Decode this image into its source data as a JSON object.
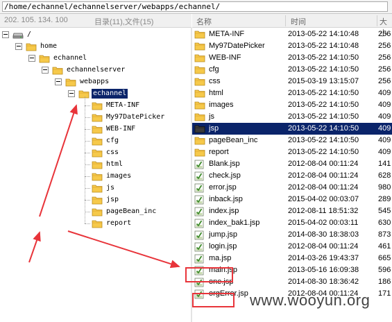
{
  "path": "/home/echannel/echannelserver/webapps/echannel/",
  "tree_header": {
    "host": "202. 105. 134. 100",
    "summary": "目录(11),文件(15)"
  },
  "list_header": {
    "name": "名称",
    "time": "时间",
    "size": "大小"
  },
  "tree": [
    {
      "label": "/",
      "level": 0,
      "kind": "drive"
    },
    {
      "label": "home",
      "level": 1,
      "kind": "folder"
    },
    {
      "label": "echannel",
      "level": 2,
      "kind": "folder"
    },
    {
      "label": "echannelserver",
      "level": 3,
      "kind": "folder"
    },
    {
      "label": "webapps",
      "level": 4,
      "kind": "folder"
    },
    {
      "label": "echannel",
      "level": 5,
      "kind": "folder",
      "selected": true
    },
    {
      "label": "META-INF",
      "level": 6,
      "kind": "folder"
    },
    {
      "label": "My97DatePicker",
      "level": 6,
      "kind": "folder"
    },
    {
      "label": "WEB-INF",
      "level": 6,
      "kind": "folder"
    },
    {
      "label": "cfg",
      "level": 6,
      "kind": "folder"
    },
    {
      "label": "css",
      "level": 6,
      "kind": "folder"
    },
    {
      "label": "html",
      "level": 6,
      "kind": "folder"
    },
    {
      "label": "images",
      "level": 6,
      "kind": "folder"
    },
    {
      "label": "js",
      "level": 6,
      "kind": "folder"
    },
    {
      "label": "jsp",
      "level": 6,
      "kind": "folder"
    },
    {
      "label": "pageBean_inc",
      "level": 6,
      "kind": "folder"
    },
    {
      "label": "report",
      "level": 6,
      "kind": "folder"
    }
  ],
  "files": [
    {
      "name": "META-INF",
      "time": "2013-05-22 14:10:48",
      "size": "256",
      "type": "folder"
    },
    {
      "name": "My97DatePicker",
      "time": "2013-05-22 14:10:48",
      "size": "256",
      "type": "folder"
    },
    {
      "name": "WEB-INF",
      "time": "2013-05-22 14:10:50",
      "size": "256",
      "type": "folder"
    },
    {
      "name": "cfg",
      "time": "2013-05-22 14:10:50",
      "size": "256",
      "type": "folder"
    },
    {
      "name": "css",
      "time": "2015-03-19 13:15:07",
      "size": "256",
      "type": "folder"
    },
    {
      "name": "html",
      "time": "2013-05-22 14:10:50",
      "size": "409",
      "type": "folder"
    },
    {
      "name": "images",
      "time": "2013-05-22 14:10:50",
      "size": "409",
      "type": "folder"
    },
    {
      "name": "js",
      "time": "2013-05-22 14:10:50",
      "size": "409",
      "type": "folder"
    },
    {
      "name": "jsp",
      "time": "2013-05-22 14:10:50",
      "size": "409",
      "type": "folder-dark",
      "selected": true
    },
    {
      "name": "pageBean_inc",
      "time": "2013-05-22 14:10:50",
      "size": "409",
      "type": "folder"
    },
    {
      "name": "report",
      "time": "2013-05-22 14:10:50",
      "size": "409",
      "type": "folder"
    },
    {
      "name": "Blank.jsp",
      "time": "2012-08-04 00:11:24",
      "size": "141",
      "type": "file"
    },
    {
      "name": "check.jsp",
      "time": "2012-08-04 00:11:24",
      "size": "628",
      "type": "file"
    },
    {
      "name": "error.jsp",
      "time": "2012-08-04 00:11:24",
      "size": "980",
      "type": "file"
    },
    {
      "name": "inback.jsp",
      "time": "2015-04-02 00:03:07",
      "size": "289",
      "type": "file"
    },
    {
      "name": "index.jsp",
      "time": "2012-08-11 18:51:32",
      "size": "545",
      "type": "file"
    },
    {
      "name": "index_bak1.jsp",
      "time": "2015-04-02 00:03:11",
      "size": "630",
      "type": "file"
    },
    {
      "name": "jump.jsp",
      "time": "2014-08-30 18:38:03",
      "size": "873",
      "type": "file"
    },
    {
      "name": "login.jsp",
      "time": "2012-08-04 00:11:24",
      "size": "461",
      "type": "file"
    },
    {
      "name": "ma.jsp",
      "time": "2014-03-26 19:43:37",
      "size": "665",
      "type": "file",
      "highlighted": true
    },
    {
      "name": "main.jsp",
      "time": "2013-05-16 16:09:38",
      "size": "596",
      "type": "file"
    },
    {
      "name": "one.jsp",
      "time": "2014-08-30 18:36:42",
      "size": "186",
      "type": "file",
      "highlighted": true
    },
    {
      "name": "orgError.jsp",
      "time": "2012-08-04 00:11:24",
      "size": "171",
      "type": "file"
    }
  ],
  "watermark": "www.wooyun.org",
  "colors": {
    "selection": "#0a246a",
    "folder": "#f6c94a",
    "highlight_box": "#e8343a",
    "arrow": "#e8343a"
  }
}
